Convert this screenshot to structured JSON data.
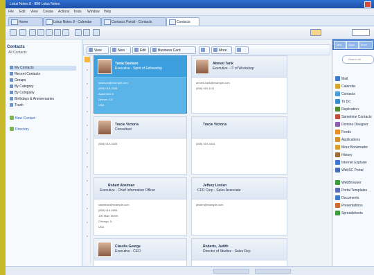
{
  "window": {
    "title": "Lotus Notes 8 - IBM Lotus Notes"
  },
  "menu": [
    "File",
    "Edit",
    "View",
    "Create",
    "Actions",
    "Tools",
    "Window",
    "Help"
  ],
  "tabs": [
    {
      "label": "Home"
    },
    {
      "label": "Lotus Notes 8 - Calendar"
    },
    {
      "label": "Contacts Portal - Contacts"
    },
    {
      "label": "Contacts"
    }
  ],
  "sidebar": {
    "title": "Contacts",
    "subtitle": "All Contacts",
    "items": [
      {
        "label": "My Contacts"
      },
      {
        "label": "Recent Contacts"
      },
      {
        "label": "Groups"
      },
      {
        "label": "By Category"
      },
      {
        "label": "By Company"
      },
      {
        "label": "Birthdays & Anniversaries"
      },
      {
        "label": "Trash"
      }
    ],
    "links": [
      {
        "label": "New Contact"
      },
      {
        "label": "Directory"
      }
    ]
  },
  "content_toolbar": {
    "view_label": "View",
    "new_label": "New",
    "edit_label": "Edit",
    "business_card_label": "Business Card",
    "more_label": "More"
  },
  "cards": [
    {
      "name": "Tania Davison",
      "title": "Executive - Spirit of Fellowship",
      "lines": [
        "tdavison@example.com",
        "(555) 019-2345",
        "Apartment 5",
        "Denver, CO",
        "USA"
      ]
    },
    {
      "name": "Ahmed Tarik",
      "title": "Executive - IT of Workshop",
      "lines": [
        "ahmed.tarik@example.com",
        "(555) 019-1111"
      ]
    },
    {
      "name": "Tracie Victoria",
      "title": "Consultant",
      "lines": [
        "(555) 019-3333"
      ]
    },
    {
      "name": "Tracie Victoria",
      "title": "",
      "lines": [
        "(555) 019-4444"
      ]
    },
    {
      "name": "Robert Abelman",
      "title": "Executive - Chief Information Officer",
      "lines": [
        "rabelman@example.com",
        "(555) 019-5555",
        "100 Main Street",
        "Chicago, IL",
        "USA"
      ]
    },
    {
      "name": "Jeffery Linden",
      "title": "CFO Corp - Sales Associate",
      "lines": [
        "jlinden@example.com"
      ]
    },
    {
      "name": "Claudia George",
      "title": "Executive - CEO",
      "lines": []
    },
    {
      "name": "Roberts, Judith",
      "title": "Director of Studies - Sales Rep",
      "lines": []
    }
  ],
  "right_panel": {
    "tabs": [
      "Tabs",
      "Apps",
      "More"
    ],
    "search_placeholder": "Search All",
    "items": [
      {
        "label": "Mail",
        "color": "#3d7ac7"
      },
      {
        "label": "Calendar",
        "color": "#d4a52b"
      },
      {
        "label": "Contacts",
        "color": "#4a9ad8"
      },
      {
        "label": "To Do",
        "color": "#3c8dd0"
      },
      {
        "label": "Replication",
        "color": "#4c8a2f"
      },
      {
        "label": "Sametime Contacts",
        "color": "#c04d3d"
      },
      {
        "label": "Domino Designer",
        "color": "#8e5fb0"
      },
      {
        "label": "Feeds",
        "color": "#e78e26"
      },
      {
        "label": "Applications",
        "color": "#d38e2f"
      },
      {
        "label": "More Bookmarks",
        "color": "#d7a02c"
      },
      {
        "label": "History",
        "color": "#9c6b35"
      },
      {
        "label": "Internet Explorer",
        "color": "#3c7ad0"
      },
      {
        "label": "WebSC Portal",
        "color": "#476eb2"
      },
      {
        "label": "WebBrowser",
        "color": "#3a9c3b"
      },
      {
        "label": "Portal Templates",
        "color": "#5b6fb7"
      },
      {
        "label": "Documents",
        "color": "#3d79c4"
      },
      {
        "label": "Presentations",
        "color": "#cf6a2e"
      },
      {
        "label": "Spreadsheets",
        "color": "#3e9b3f"
      }
    ]
  }
}
